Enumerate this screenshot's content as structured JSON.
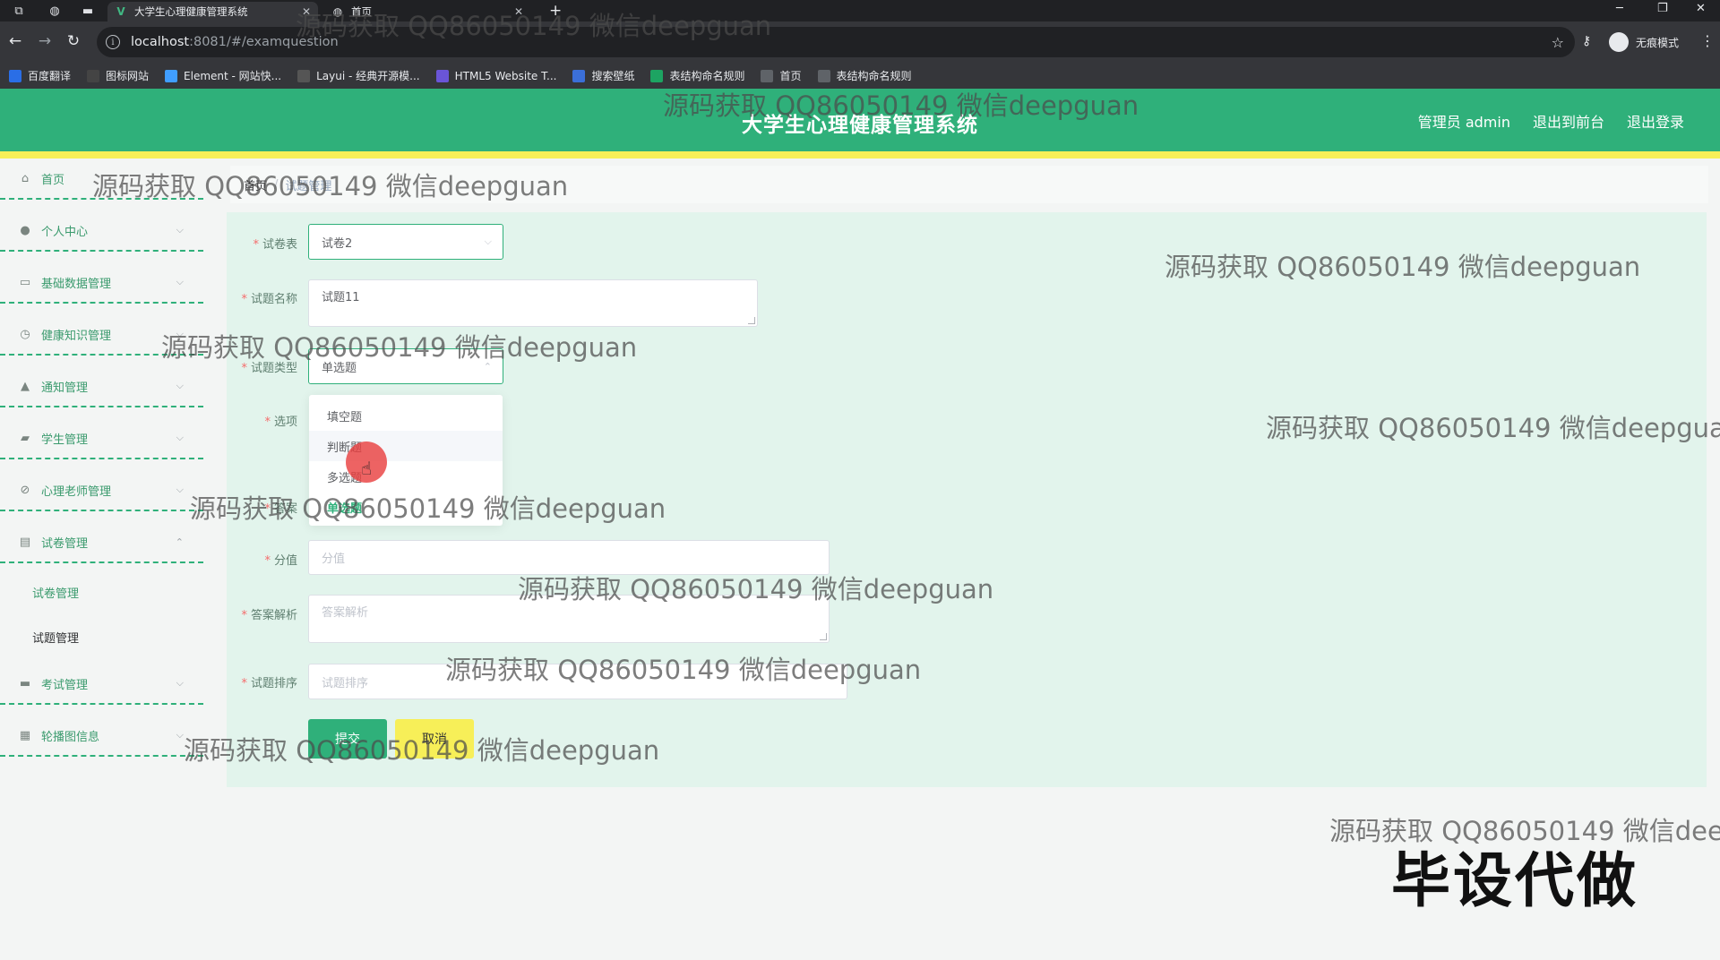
{
  "browser": {
    "tabs": [
      {
        "title": "大学生心理健康管理系统",
        "active": true
      },
      {
        "title": "首页",
        "active": false
      }
    ],
    "url_host": "localhost",
    "url_path": ":8081/#/examquestion",
    "incognito_label": "无痕模式",
    "bookmarks": [
      {
        "label": "百度翻译",
        "icon": "translate-icon",
        "color": "#2a6ee6"
      },
      {
        "label": "图标网站",
        "icon": "flag-icon",
        "color": "#444444"
      },
      {
        "label": "Element - 网站快...",
        "icon": "element-icon",
        "color": "#409eff"
      },
      {
        "label": "Layui - 经典开源模...",
        "icon": "layui-icon",
        "color": "#555555"
      },
      {
        "label": "HTML5 Website T...",
        "icon": "html5-icon",
        "color": "#6a55d8"
      },
      {
        "label": "搜索壁纸",
        "icon": "wallpaper-icon",
        "color": "#3b6fd8"
      },
      {
        "label": "表结构命名规则",
        "icon": "sheet-icon",
        "color": "#1da462"
      },
      {
        "label": "首页",
        "icon": "globe-icon",
        "color": "#5f6368"
      },
      {
        "label": "表结构命名规则",
        "icon": "globe-icon",
        "color": "#5f6368"
      }
    ]
  },
  "header": {
    "title": "大学生心理健康管理系统",
    "user": "管理员 admin",
    "back_to_front": "退出到前台",
    "logout": "退出登录"
  },
  "sidebar": {
    "items": [
      {
        "label": "首页",
        "icon": "home-icon",
        "has_chevron": false
      },
      {
        "label": "个人中心",
        "icon": "user-icon",
        "has_chevron": true
      },
      {
        "label": "基础数据管理",
        "icon": "chat-icon",
        "has_chevron": true
      },
      {
        "label": "健康知识管理",
        "icon": "clock-icon",
        "has_chevron": true
      },
      {
        "label": "通知管理",
        "icon": "bell-icon",
        "has_chevron": true
      },
      {
        "label": "学生管理",
        "icon": "comment-icon",
        "has_chevron": true
      },
      {
        "label": "心理老师管理",
        "icon": "bell-off-icon",
        "has_chevron": true
      },
      {
        "label": "试卷管理",
        "icon": "document-icon",
        "has_chevron": true
      },
      {
        "label": "考试管理",
        "icon": "monitor-icon",
        "has_chevron": true
      },
      {
        "label": "轮播图信息",
        "icon": "grid-icon",
        "has_chevron": true
      }
    ],
    "sub_items": [
      "试卷管理",
      "试题管理"
    ]
  },
  "breadcrumb": {
    "home": "首页",
    "current": "试题管理"
  },
  "form": {
    "paper_label": "试卷表",
    "paper_value": "试卷2",
    "name_label": "试题名称",
    "name_value": "试题11",
    "type_label": "试题类型",
    "type_value": "单选题",
    "options_label": "选项",
    "answer_label": "答案",
    "score_label": "分值",
    "score_placeholder": "分值",
    "analysis_label": "答案解析",
    "analysis_placeholder": "答案解析",
    "order_label": "试题排序",
    "order_placeholder": "试题排序",
    "submit": "提交",
    "cancel": "取消"
  },
  "dropdown_options": [
    "填空题",
    "判断题",
    "多选题",
    "单选题"
  ],
  "watermarks": {
    "text": "源码获取 QQ86050149 微信deepguan",
    "badge": "毕设代做"
  },
  "colors": {
    "header_green": "#2fb07a",
    "accent_yellow": "#f7ef58",
    "panel_bg": "#e2f4ec"
  }
}
